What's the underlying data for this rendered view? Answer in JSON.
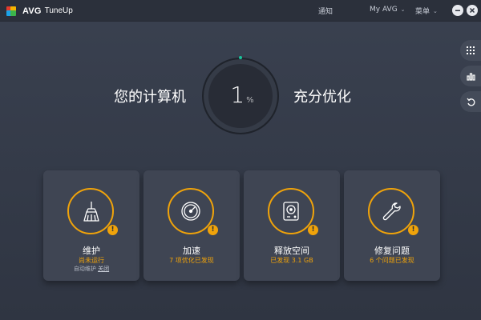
{
  "app": {
    "brand": "AVG",
    "product": "TuneUp"
  },
  "topbar": {
    "notifications": "通知",
    "my_avg": "My AVG",
    "menu": "菜单"
  },
  "hero": {
    "left_text": "您的计算机",
    "right_text": "充分优化",
    "progress_value": "1",
    "progress_unit": "%",
    "progress_fraction": 0.01
  },
  "cards": [
    {
      "title": "维护",
      "status": "尚未运行",
      "sub_text": "自动维护",
      "sub_link": "关闭",
      "icon": "broom-icon"
    },
    {
      "title": "加速",
      "status": "7 项优化已发现",
      "icon": "speedometer-icon"
    },
    {
      "title": "释放空间",
      "status": "已发现 3.1 GB",
      "icon": "hard-drive-icon"
    },
    {
      "title": "修复问题",
      "status": "6 个问题已发现",
      "icon": "wrench-icon"
    }
  ],
  "badge_symbol": "!",
  "colors": {
    "accent": "#f0a30a",
    "progress_dot": "#19c39b",
    "background": "#353b48",
    "card": "#3f4553"
  }
}
